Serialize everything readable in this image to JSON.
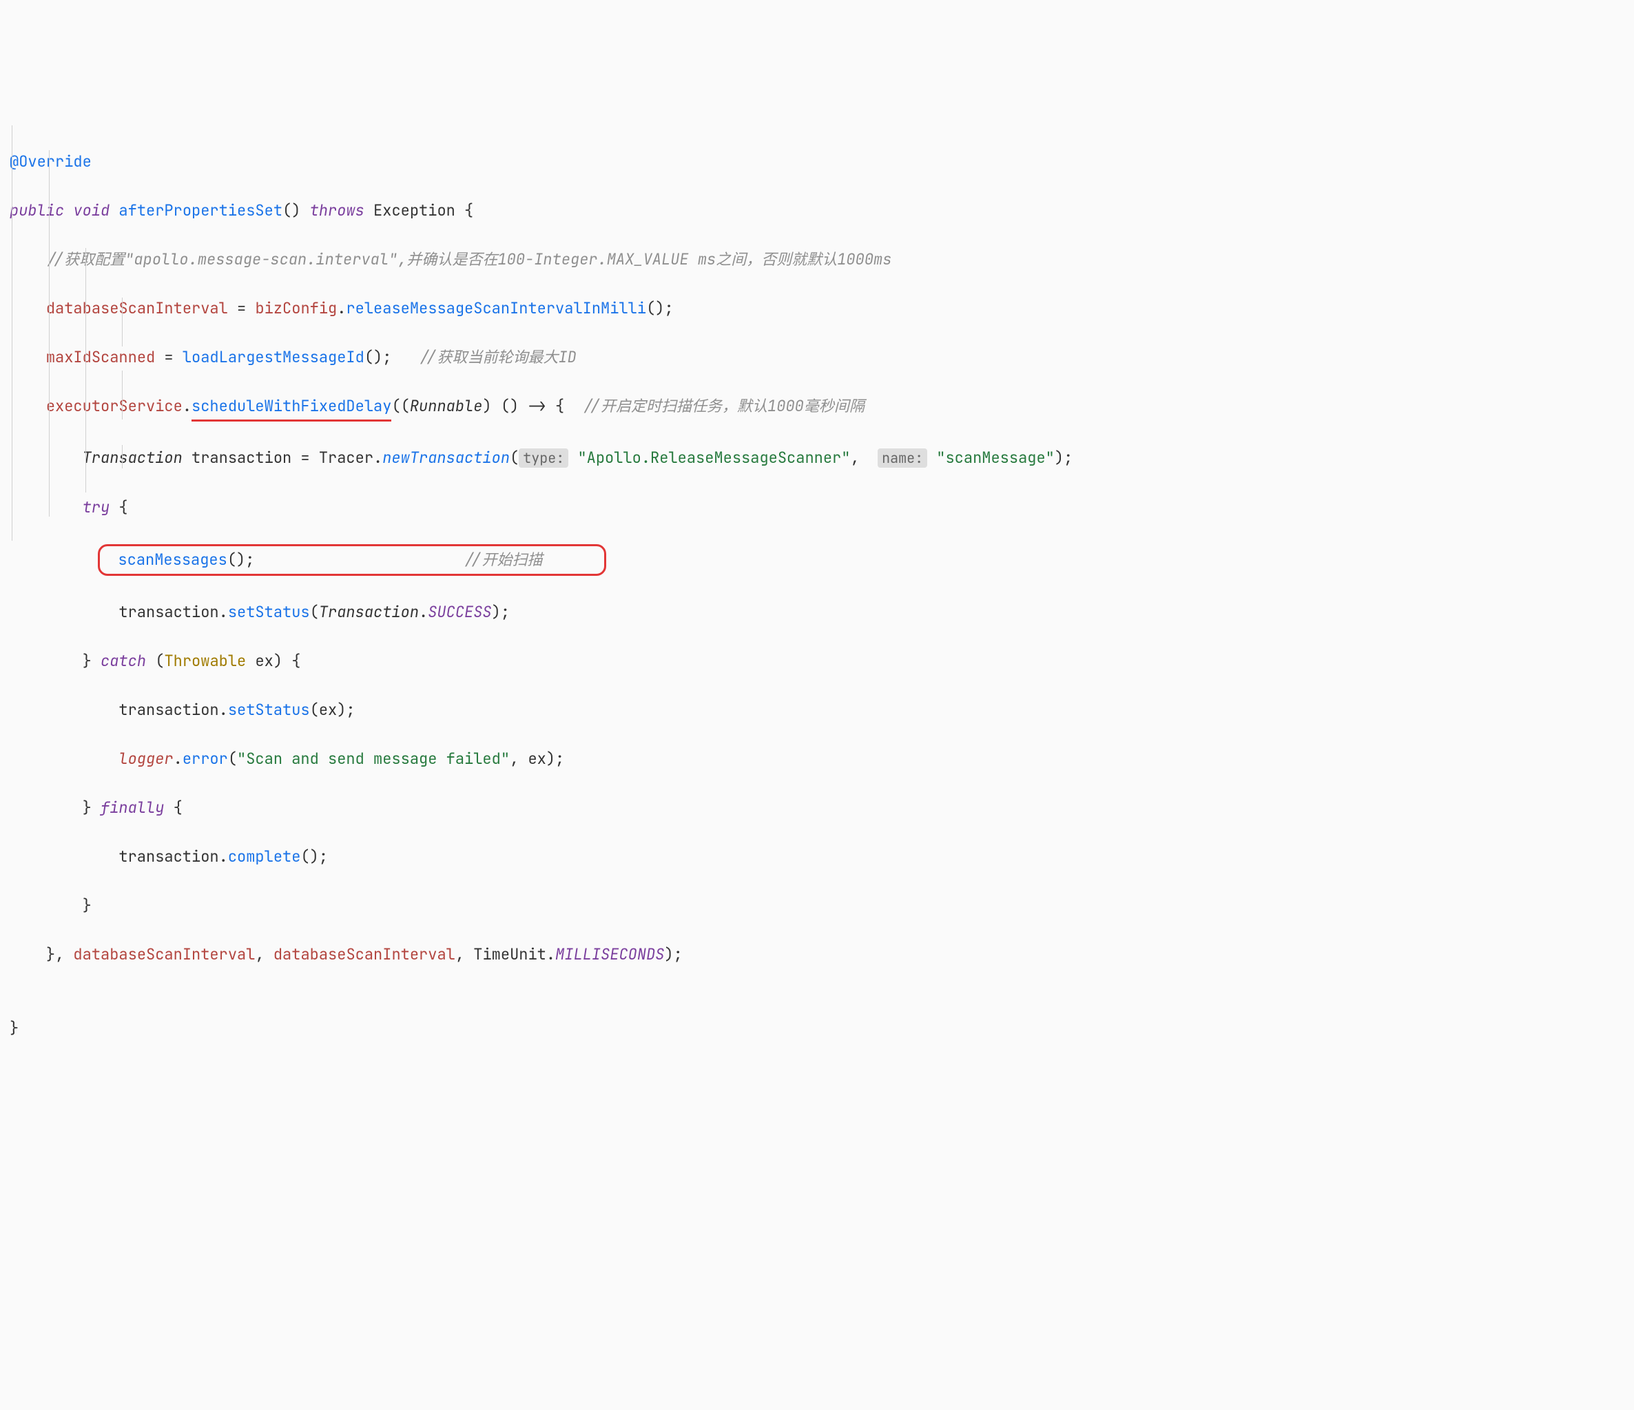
{
  "l1": {
    "annotation": "@Override"
  },
  "l2": {
    "k_public": "public",
    "k_void": "void",
    "m_aps": "afterPropertiesSet",
    "p1": "() ",
    "k_throws": "throws",
    "sp": " ",
    "t_ex": "Exception",
    "brace": " {"
  },
  "l3": {
    "cmt": "//获取配置\"apollo.message-scan.interval\",并确认是否在100-Integer.MAX_VALUE ms之间，否则就默认1000ms"
  },
  "l4": {
    "f_dsi": "databaseScanInterval",
    "eq": " = ",
    "f_biz": "bizConfig",
    "dot": ".",
    "m_rel": "releaseMessageScanIntervalInMilli",
    "end": "();"
  },
  "l5": {
    "f_mis": "maxIdScanned",
    "eq": " = ",
    "m_load": "loadLargestMessageId",
    "end": "();   ",
    "cmt": "//获取当前轮询最大ID"
  },
  "l6": {
    "f_exec": "executorService",
    "dot": ".",
    "m_sched": "scheduleWithFixedDelay",
    "p1": "((",
    "t_run": "Runnable",
    "p2": ") () -> {  ",
    "cmt": "//开启定时扫描任务，默认1000毫秒间隔"
  },
  "l7": {
    "t_trans": "Transaction",
    "sp": " ",
    "v_trans": "transaction",
    "eq": " = ",
    "t_tracer": "Tracer",
    "dot": ".",
    "m_new": "newTransaction",
    "p1": "(",
    "hint_type": "type:",
    "sp2": " ",
    "s_apollo": "\"Apollo.ReleaseMessageScanner\"",
    "comma": ",  ",
    "hint_name": "name:",
    "sp3": " ",
    "s_scan": "\"scanMessage\"",
    "end": ");"
  },
  "l8": {
    "k_try": "try",
    "brace": " {"
  },
  "l9": {
    "m_scan": "scanMessages",
    "end": "();",
    "cmt": "//开始扫描"
  },
  "l10": {
    "v_trans": "transaction",
    "dot1": ".",
    "m_set": "setStatus",
    "p1": "(",
    "t_trans": "Transaction",
    "dot2": ".",
    "f_succ": "SUCCESS",
    "end": ");"
  },
  "l11": {
    "brace": "} ",
    "k_catch": "catch",
    "p1": " (",
    "t_throw": "Throwable",
    "ex": " ex) {"
  },
  "l12": {
    "v_trans": "transaction",
    "dot": ".",
    "m_set": "setStatus",
    "end": "(ex);"
  },
  "l13": {
    "f_log": "logger",
    "dot": ".",
    "m_err": "error",
    "p1": "(",
    "s_msg": "\"Scan and send message failed\"",
    "end": ", ex);"
  },
  "l14": {
    "brace": "} ",
    "k_fin": "finally",
    "brace2": " {"
  },
  "l15": {
    "v_trans": "transaction",
    "dot": ".",
    "m_comp": "complete",
    "end": "();"
  },
  "l16": {
    "brace": "}"
  },
  "l17": {
    "brace": "}, ",
    "f_dsi1": "databaseScanInterval",
    "c1": ", ",
    "f_dsi2": "databaseScanInterval",
    "c2": ", ",
    "t_tu": "TimeUnit",
    "dot": ".",
    "f_ms": "MILLISECONDS",
    "end": ");"
  },
  "l18": {
    "brace": "}"
  }
}
